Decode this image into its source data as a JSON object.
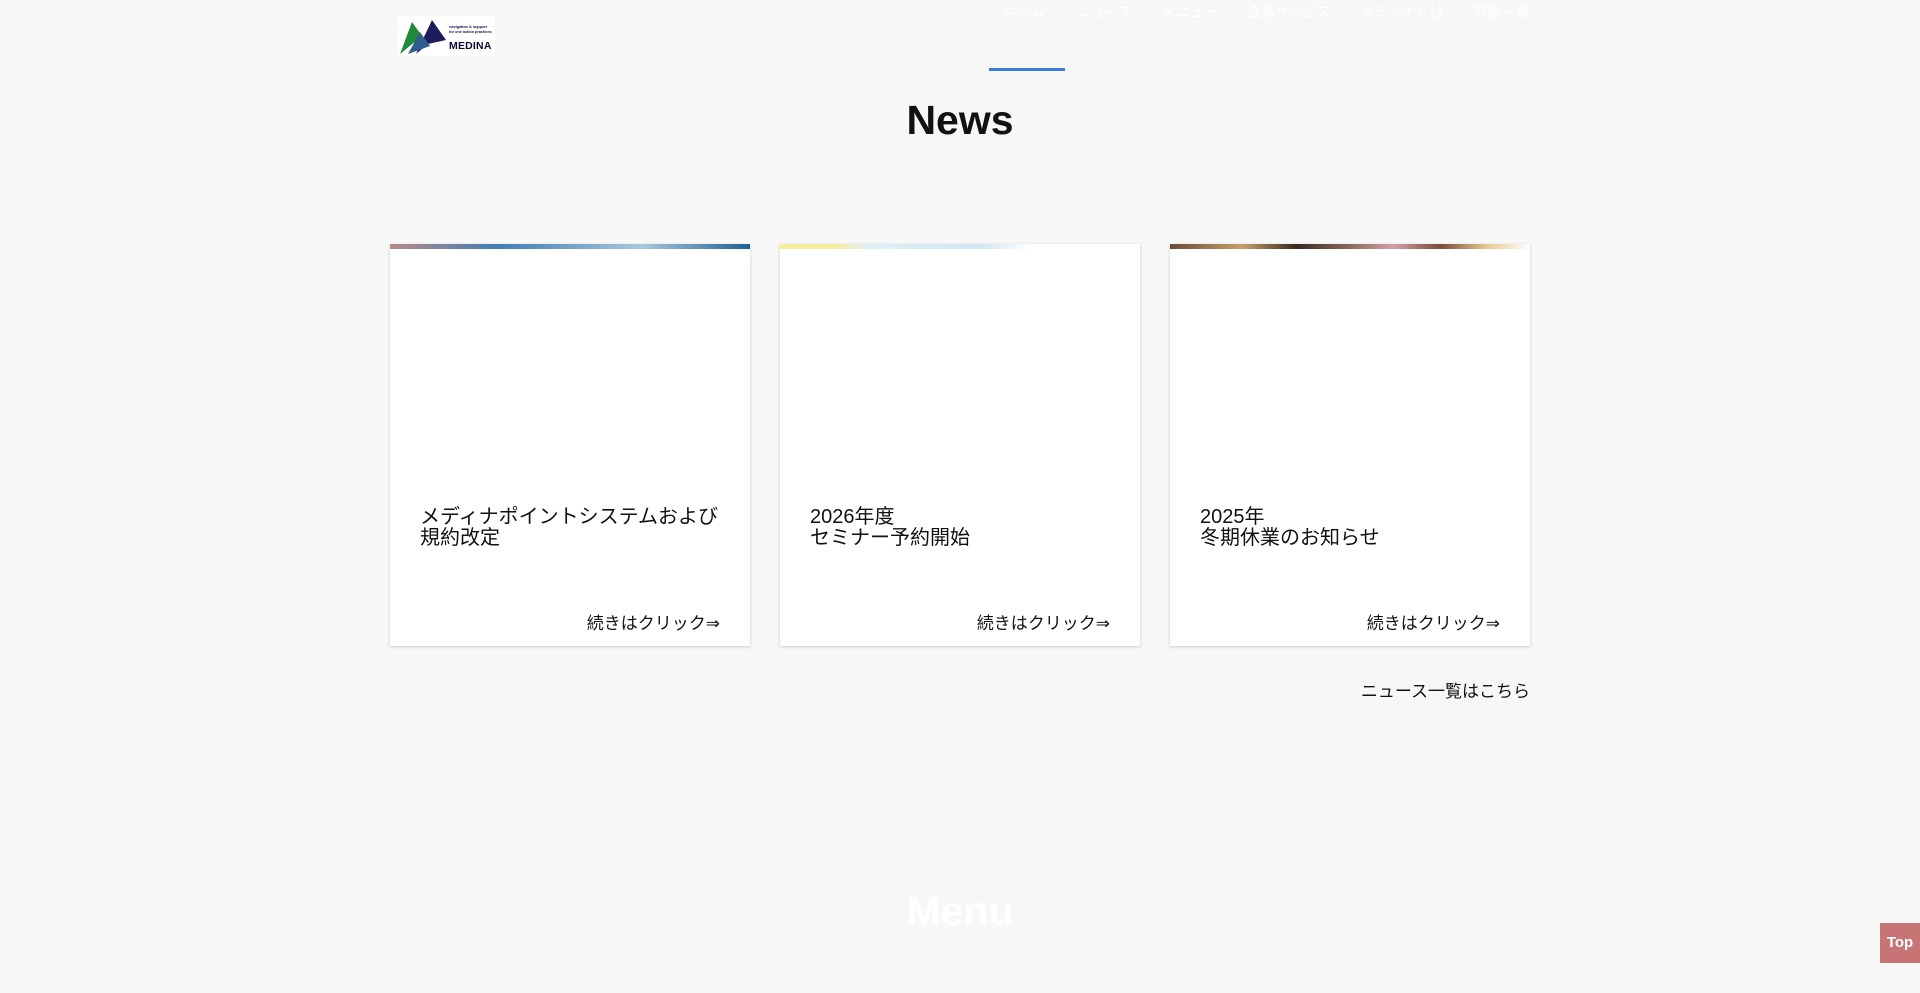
{
  "header": {
    "logo": {
      "alt_name": "MEDINA",
      "tagline": "navigation & support\nfor one action practices",
      "brand": "MEDINA"
    },
    "nav": [
      {
        "label": "ホーム"
      },
      {
        "label": "ニュース"
      },
      {
        "label": "メニュー"
      },
      {
        "label": "会員サービス"
      },
      {
        "label": "メディナとは"
      },
      {
        "label": "取扱一覧"
      }
    ],
    "active_index": 0
  },
  "news": {
    "title": "News",
    "cards": [
      {
        "title": "メディナポイントシステムおよび\n規約改定",
        "more": "続きはクリック⇒"
      },
      {
        "title": "2026年度\nセミナー予約開始",
        "more": "続きはクリック⇒"
      },
      {
        "title": "2025年\n冬期休業のお知らせ",
        "more": "続きはクリック⇒"
      }
    ],
    "list_link": "ニュース一覧はこちら"
  },
  "menu": {
    "title": "Menu"
  },
  "top_button": {
    "label": "Top"
  },
  "colors": {
    "background": "#f7f7f7",
    "accent_underline": "#3b7ddd",
    "top_button": "#c77474",
    "logo_green": "#1f8a3a",
    "logo_navy": "#1d1d5e"
  }
}
